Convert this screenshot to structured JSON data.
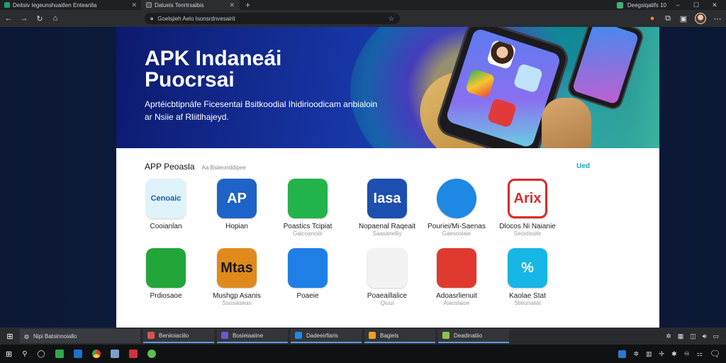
{
  "browser": {
    "tabs": [
      {
        "title": "Deitsiv Iegeunshuaitlen Enteanlla",
        "color": "#20a070",
        "active": false
      },
      {
        "title": "Dalueis Tenrtrsaibis",
        "color": "#3a3a3a",
        "active": true
      }
    ],
    "tab_right_label": "Deegsiqatifs 10",
    "url": "Goelsjieh Aelo Isonsrdnvesairit"
  },
  "hero": {
    "title": "APK Indaneái Puocrsai",
    "subtitle": "Aprtéicbtipnáfe Ficesentai Bsitkoodial Ihidirioodicam anbialoin ar Nsiie af Rliitlhajeyd."
  },
  "section": {
    "title": "APP Peoasla",
    "subtitle": "Aa Bsiieonddipee",
    "more_link": "Ued"
  },
  "apps": [
    {
      "name": "Cooianlan",
      "category": "",
      "icon_label": "Cenoaic",
      "icon": "cenoaic-icon",
      "bg": "#dff3fb",
      "fg": "#1b5fa8"
    },
    {
      "name": "Hopian",
      "category": "",
      "icon_label": "AP",
      "icon": "ap-icon",
      "bg": "#1e63c8",
      "fg": "#ffffff"
    },
    {
      "name": "Poastics Tcipiat",
      "category": "Gaicoanciiir",
      "icon_label": "",
      "icon": "green-chat-icon",
      "bg": "#22b34a",
      "fg": "#ffffff"
    },
    {
      "name": "Nopaenal Raqeait",
      "category": "Saasaneliiy",
      "icon_label": "Iasa",
      "icon": "blue-oval-icon",
      "bg": "#1d4fb0",
      "fg": "#ffffff"
    },
    {
      "name": "Pouriei/Mi-Saenas",
      "category": "Gaesooiaie",
      "icon_label": "",
      "icon": "blue-circle-icon",
      "bg": "#1e88e5",
      "fg": "#ffffff"
    },
    {
      "name": "Dlocos Ni Naianie",
      "category": "Seostissite",
      "icon_label": "Arix",
      "icon": "red-bubble-icon",
      "bg": "#ffffff",
      "fg": "#d82b2b"
    },
    {
      "name": "Prdiosaoe",
      "category": "",
      "icon_label": "",
      "icon": "green-drive-icon",
      "bg": "#22a63a",
      "fg": "#ffffff"
    },
    {
      "name": "Mushgp Asanis",
      "category": "Ssosiaseas",
      "icon_label": "Mtas",
      "icon": "orange-game-icon",
      "bg": "#e08a1c",
      "fg": "#1a1a1a"
    },
    {
      "name": "Poaeie",
      "category": "",
      "icon_label": "",
      "icon": "blue-n-icon",
      "bg": "#1f7fe6",
      "fg": "#ffffff"
    },
    {
      "name": "Poaeaillalice",
      "category": "Qiuui",
      "icon_label": "",
      "icon": "play-icon",
      "bg": "#f2f2f2",
      "fg": "#e33b3b"
    },
    {
      "name": "Adoasrlienuit",
      "category": "Aiaoslaioe",
      "icon_label": "",
      "icon": "red-target-icon",
      "bg": "#e03a2f",
      "fg": "#ffffff"
    },
    {
      "name": "Kaolae Stat",
      "category": "Stieunaiiat",
      "icon_label": "%",
      "icon": "cyan-percent-icon",
      "bg": "#16b6e6",
      "fg": "#ffffff"
    }
  ],
  "taskbar": {
    "search_text": "Nipi Batsinnoiallo",
    "tasks": [
      {
        "label": "Beniioiaciilo",
        "color": "#d9534f"
      },
      {
        "label": "Bosleiaaiine",
        "color": "#6a5acd"
      },
      {
        "label": "Dadeeirflaris",
        "color": "#1e88e5"
      },
      {
        "label": "Bagiels",
        "color": "#f0a020"
      },
      {
        "label": "Deadinatiio",
        "color": "#8bc34a"
      }
    ]
  }
}
